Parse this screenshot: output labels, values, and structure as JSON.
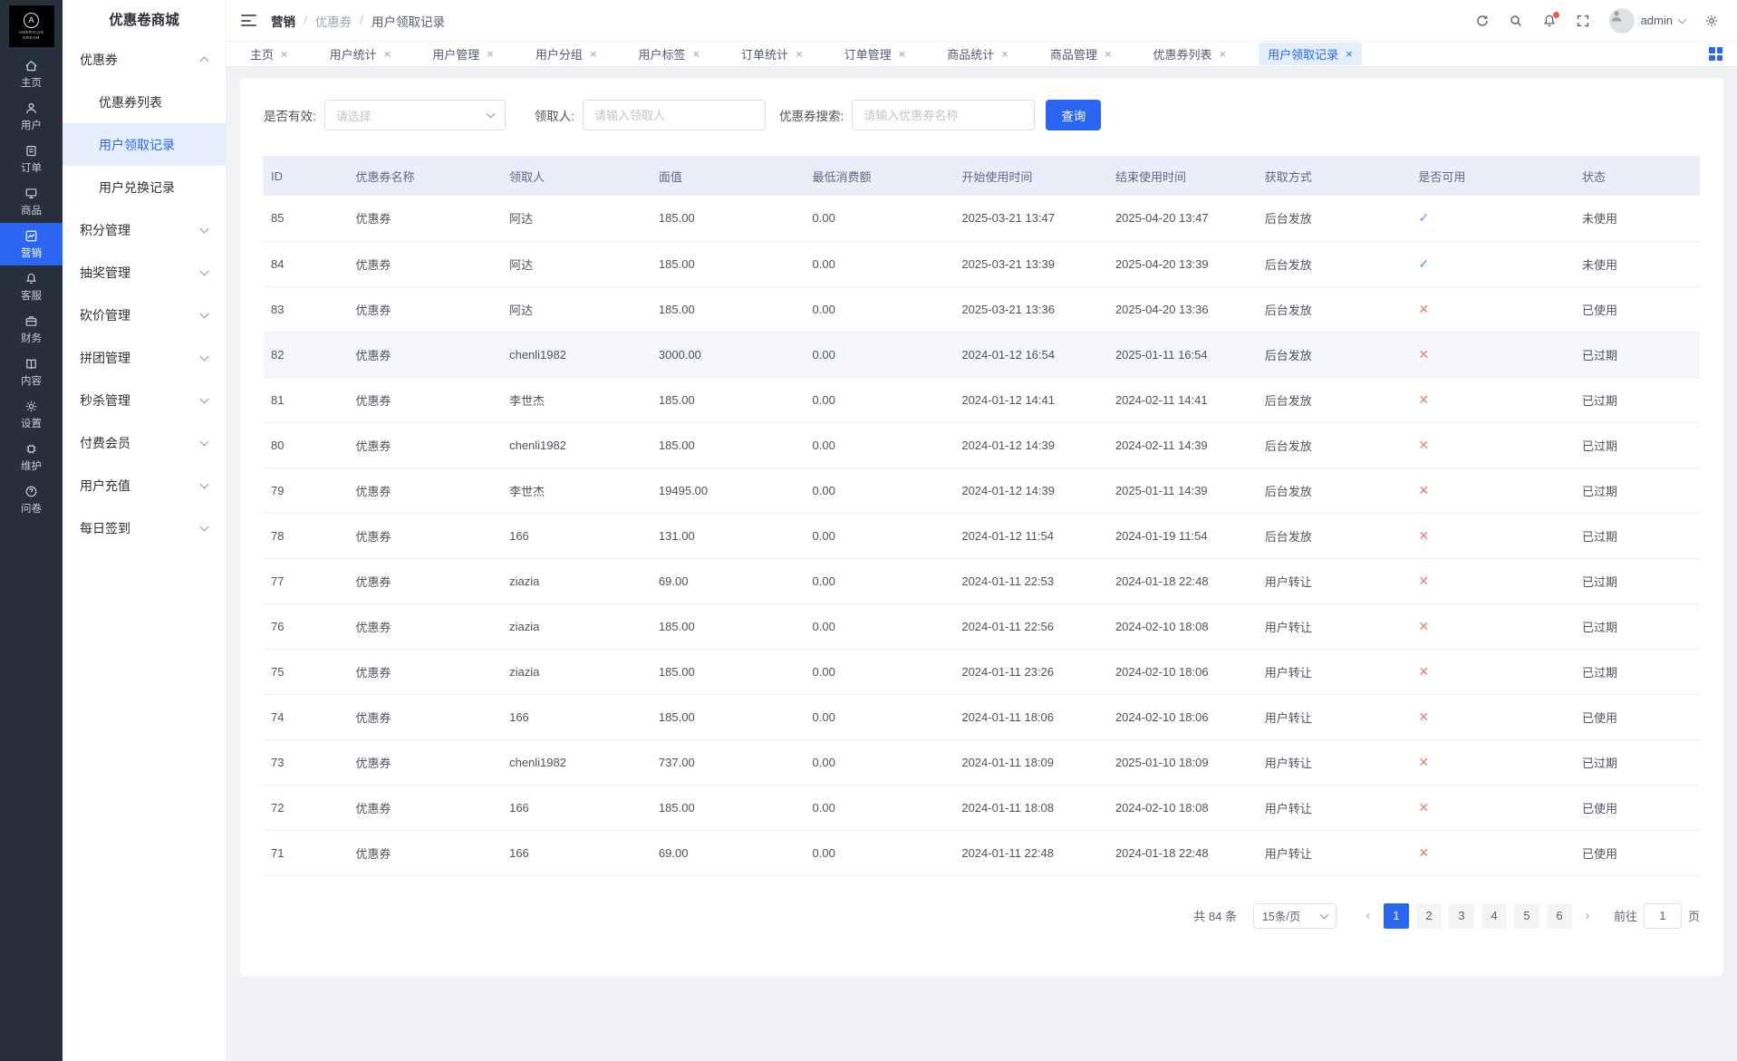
{
  "app": {
    "title": "优惠卷商城",
    "logo_monogram": "A",
    "logo_text": "AMERICAN\nDREAM"
  },
  "rail": {
    "items": [
      {
        "label": "主页"
      },
      {
        "label": "用户"
      },
      {
        "label": "订单"
      },
      {
        "label": "商品"
      },
      {
        "label": "营销",
        "active": true
      },
      {
        "label": "客服"
      },
      {
        "label": "财务"
      },
      {
        "label": "内容"
      },
      {
        "label": "设置"
      },
      {
        "label": "维护"
      },
      {
        "label": "问卷"
      }
    ]
  },
  "submenu": {
    "coupon_group": {
      "label": "优惠券",
      "children": [
        {
          "label": "优惠券列表"
        },
        {
          "label": "用户领取记录",
          "active": true
        },
        {
          "label": "用户兑换记录"
        }
      ]
    },
    "groups": [
      {
        "label": "积分管理"
      },
      {
        "label": "抽奖管理"
      },
      {
        "label": "砍价管理"
      },
      {
        "label": "拼团管理"
      },
      {
        "label": "秒杀管理"
      },
      {
        "label": "付费会员"
      },
      {
        "label": "用户充值"
      },
      {
        "label": "每日签到"
      }
    ]
  },
  "header": {
    "breadcrumb": [
      "营销",
      "优惠券",
      "用户领取记录"
    ],
    "user": "admin"
  },
  "tabs": [
    {
      "label": "主页"
    },
    {
      "label": "用户统计"
    },
    {
      "label": "用户管理"
    },
    {
      "label": "用户分组"
    },
    {
      "label": "用户标签"
    },
    {
      "label": "订单统计"
    },
    {
      "label": "订单管理"
    },
    {
      "label": "商品统计"
    },
    {
      "label": "商品管理"
    },
    {
      "label": "优惠券列表"
    },
    {
      "label": "用户领取记录",
      "active": true
    }
  ],
  "filters": {
    "valid_label": "是否有效:",
    "valid_placeholder": "请选择",
    "receiver_label": "领取人:",
    "receiver_placeholder": "请输入领取人",
    "coupon_label": "优惠券搜索:",
    "coupon_placeholder": "请输入优惠券名称",
    "search_button": "查询"
  },
  "table": {
    "columns": [
      "ID",
      "优惠券名称",
      "领取人",
      "面值",
      "最低消费额",
      "开始使用时间",
      "结束使用时间",
      "获取方式",
      "是否可用",
      "状态"
    ],
    "rows": [
      {
        "id": "85",
        "name": "优惠券",
        "receiver": "阿达",
        "value": "185.00",
        "min": "0.00",
        "start": "2025-03-21 13:47",
        "end": "2025-04-20 13:47",
        "method": "后台发放",
        "usable": true,
        "status": "未使用"
      },
      {
        "id": "84",
        "name": "优惠券",
        "receiver": "阿达",
        "value": "185.00",
        "min": "0.00",
        "start": "2025-03-21 13:39",
        "end": "2025-04-20 13:39",
        "method": "后台发放",
        "usable": true,
        "status": "未使用"
      },
      {
        "id": "83",
        "name": "优惠券",
        "receiver": "阿达",
        "value": "185.00",
        "min": "0.00",
        "start": "2025-03-21 13:36",
        "end": "2025-04-20 13:36",
        "method": "后台发放",
        "usable": false,
        "status": "已使用"
      },
      {
        "id": "82",
        "name": "优惠券",
        "receiver": "chenli1982",
        "value": "3000.00",
        "min": "0.00",
        "start": "2024-01-12 16:54",
        "end": "2025-01-11 16:54",
        "method": "后台发放",
        "usable": false,
        "status": "已过期",
        "hover": true
      },
      {
        "id": "81",
        "name": "优惠券",
        "receiver": "李世杰",
        "value": "185.00",
        "min": "0.00",
        "start": "2024-01-12 14:41",
        "end": "2024-02-11 14:41",
        "method": "后台发放",
        "usable": false,
        "status": "已过期"
      },
      {
        "id": "80",
        "name": "优惠券",
        "receiver": "chenli1982",
        "value": "185.00",
        "min": "0.00",
        "start": "2024-01-12 14:39",
        "end": "2024-02-11 14:39",
        "method": "后台发放",
        "usable": false,
        "status": "已过期"
      },
      {
        "id": "79",
        "name": "优惠券",
        "receiver": "李世杰",
        "value": "19495.00",
        "min": "0.00",
        "start": "2024-01-12 14:39",
        "end": "2025-01-11 14:39",
        "method": "后台发放",
        "usable": false,
        "status": "已过期"
      },
      {
        "id": "78",
        "name": "优惠券",
        "receiver": "166",
        "value": "131.00",
        "min": "0.00",
        "start": "2024-01-12 11:54",
        "end": "2024-01-19 11:54",
        "method": "后台发放",
        "usable": false,
        "status": "已过期"
      },
      {
        "id": "77",
        "name": "优惠券",
        "receiver": "ziazia",
        "value": "69.00",
        "min": "0.00",
        "start": "2024-01-11 22:53",
        "end": "2024-01-18 22:48",
        "method": "用户转让",
        "usable": false,
        "status": "已过期"
      },
      {
        "id": "76",
        "name": "优惠券",
        "receiver": "ziazia",
        "value": "185.00",
        "min": "0.00",
        "start": "2024-01-11 22:56",
        "end": "2024-02-10 18:08",
        "method": "用户转让",
        "usable": false,
        "status": "已过期"
      },
      {
        "id": "75",
        "name": "优惠券",
        "receiver": "ziazia",
        "value": "185.00",
        "min": "0.00",
        "start": "2024-01-11 23:26",
        "end": "2024-02-10 18:06",
        "method": "用户转让",
        "usable": false,
        "status": "已过期"
      },
      {
        "id": "74",
        "name": "优惠券",
        "receiver": "166",
        "value": "185.00",
        "min": "0.00",
        "start": "2024-01-11 18:06",
        "end": "2024-02-10 18:06",
        "method": "用户转让",
        "usable": false,
        "status": "已使用"
      },
      {
        "id": "73",
        "name": "优惠券",
        "receiver": "chenli1982",
        "value": "737.00",
        "min": "0.00",
        "start": "2024-01-11 18:09",
        "end": "2025-01-10 18:09",
        "method": "用户转让",
        "usable": false,
        "status": "已过期"
      },
      {
        "id": "72",
        "name": "优惠券",
        "receiver": "166",
        "value": "185.00",
        "min": "0.00",
        "start": "2024-01-11 18:08",
        "end": "2024-02-10 18:08",
        "method": "用户转让",
        "usable": false,
        "status": "已使用"
      },
      {
        "id": "71",
        "name": "优惠券",
        "receiver": "166",
        "value": "69.00",
        "min": "0.00",
        "start": "2024-01-11 22:48",
        "end": "2024-01-18 22:48",
        "method": "用户转让",
        "usable": false,
        "status": "已使用"
      }
    ]
  },
  "pagination": {
    "total": "共 84 条",
    "page_size": "15条/页",
    "pages": [
      {
        "label": "1",
        "active": true
      },
      {
        "label": "2"
      },
      {
        "label": "3"
      },
      {
        "label": "4"
      },
      {
        "label": "5"
      },
      {
        "label": "6"
      }
    ],
    "prev": "‹",
    "next": "›",
    "goto_label": "前往",
    "goto_value": "1",
    "goto_suffix": "页"
  }
}
